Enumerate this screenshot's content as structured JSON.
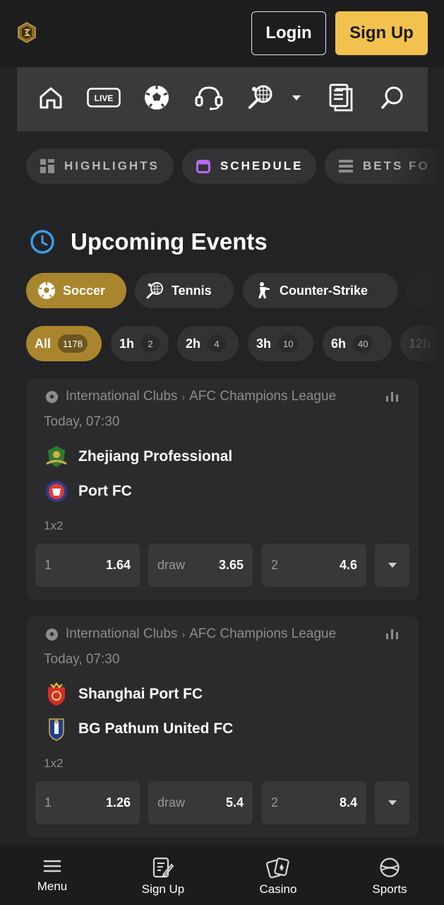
{
  "header": {
    "login_label": "Login",
    "signup_label": "Sign Up",
    "logo_icon": "gold-shield-logo-icon"
  },
  "nav_icons": [
    "home-icon",
    "live-icon",
    "soccer-ball-icon",
    "headset-icon",
    "tennis-racket-icon",
    "chevron-down-icon",
    "betslip-icon",
    "search-icon"
  ],
  "nav": {
    "live_text": "LIVE"
  },
  "filters": [
    {
      "label": "HIGHLIGHTS",
      "icon": "grid-icon"
    },
    {
      "label": "SCHEDULE",
      "icon": "calendar-icon"
    },
    {
      "label": "BETS FO",
      "icon": "list-icon"
    }
  ],
  "section": {
    "title": "Upcoming Events",
    "icon": "clock-icon"
  },
  "sports": [
    {
      "label": "Soccer",
      "icon": "soccer-ball-icon",
      "active": true
    },
    {
      "label": "Tennis",
      "icon": "tennis-racket-icon",
      "active": false
    },
    {
      "label": "Counter-Strike",
      "icon": "soldier-icon",
      "active": false
    }
  ],
  "time_filters": [
    {
      "label": "All",
      "count": "1178",
      "active": true
    },
    {
      "label": "1h",
      "count": "2",
      "active": false
    },
    {
      "label": "2h",
      "count": "4",
      "active": false
    },
    {
      "label": "3h",
      "count": "10",
      "active": false
    },
    {
      "label": "6h",
      "count": "40",
      "active": false
    },
    {
      "label": "12h",
      "count": "",
      "active": false
    }
  ],
  "events": [
    {
      "category": "International Clubs",
      "league": "AFC Champions League",
      "time": "Today, 07:30",
      "home": "Zhejiang Professional",
      "away": "Port FC",
      "market": "1x2",
      "odds": [
        {
          "label": "1",
          "value": "1.64"
        },
        {
          "label": "draw",
          "value": "3.65"
        },
        {
          "label": "2",
          "value": "4.6"
        }
      ]
    },
    {
      "category": "International Clubs",
      "league": "AFC Champions League",
      "time": "Today, 07:30",
      "home": "Shanghai Port FC",
      "away": "BG Pathum United FC",
      "market": "1x2",
      "odds": [
        {
          "label": "1",
          "value": "1.26"
        },
        {
          "label": "draw",
          "value": "5.4"
        },
        {
          "label": "2",
          "value": "8.4"
        }
      ]
    }
  ],
  "bottom_nav": [
    {
      "label": "Menu",
      "icon": "hamburger-icon"
    },
    {
      "label": "Sign Up",
      "icon": "signup-form-icon"
    },
    {
      "label": "Casino",
      "icon": "cards-icon"
    },
    {
      "label": "Sports",
      "icon": "ball-icon"
    }
  ],
  "colors": {
    "accent": "#f2c14e",
    "active_pill": "#a9852e",
    "background": "#232325",
    "card": "#2b2b2d",
    "clock_blue": "#3b9ee8",
    "calendar_purple": "#b46bf0"
  }
}
